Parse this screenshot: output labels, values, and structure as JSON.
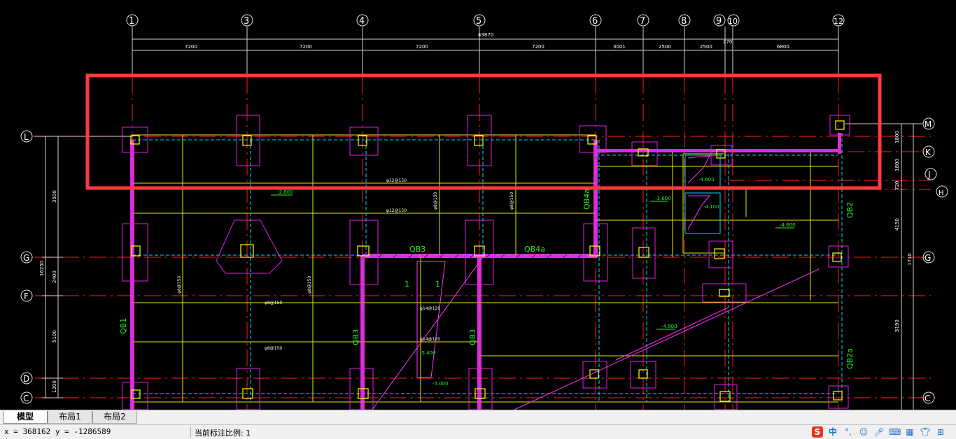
{
  "drawing": {
    "axis_numbers": [
      "1",
      "3",
      "4",
      "5",
      "6",
      "7",
      "8",
      "9",
      "10",
      "12"
    ],
    "axis_letters_left": [
      "L",
      "G",
      "F",
      "D",
      "C"
    ],
    "axis_letters_right": [
      "M",
      "K",
      "J",
      "H",
      "G",
      "C"
    ],
    "top_dims": [
      "7200",
      "7200",
      "7200",
      "7200",
      "3001",
      "2500",
      "2500",
      "270",
      "6800"
    ],
    "overall_dim": "43870",
    "right_dims": [
      "1800",
      "1800",
      "720",
      "4150",
      "1710",
      "5190"
    ],
    "left_dims": [
      "3500",
      "2400",
      "5100",
      "1200"
    ],
    "left_total_dim": "16250",
    "beam_labels": [
      "QB3",
      "QB4a",
      "QB1",
      "QB3",
      "QB3",
      "QB4a",
      "QB2",
      "QB2a"
    ],
    "section_marks": [
      "1",
      "1"
    ],
    "elevations": [
      "-2.800",
      "-3.600",
      "-4.600",
      "-4.100",
      "-4.600",
      "-5.400",
      "-4.800",
      "-5.000"
    ],
    "rebar_notes": [
      "φ12@150",
      "φ12@150",
      "φ8@150",
      "φ8@150",
      "φ8@150",
      "φ8@150",
      "φ14@120",
      "φ14@120",
      "φ8@150",
      "φ8@150"
    ]
  },
  "tabs": {
    "model": "模型",
    "layout1": "布局1",
    "layout2": "布局2"
  },
  "status": {
    "coords": "x = 368162  y = -1286589",
    "scale": "当前标注比例: 1"
  },
  "ime": {
    "logo": "S",
    "lang": "中",
    "punct": "°,"
  },
  "colors": {
    "highlight": "#ff3b3b",
    "axis_red": "#e02020",
    "wall_magenta": "#ff33ff",
    "beam_yellow": "#ffff00",
    "cyan": "#00e5ff",
    "label_green": "#33ff33",
    "white": "#ffffff"
  }
}
